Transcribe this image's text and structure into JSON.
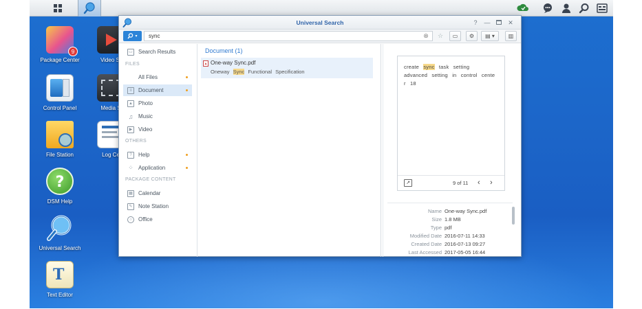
{
  "window": {
    "title": "Universal Search"
  },
  "search": {
    "query": "sync"
  },
  "sidebar": {
    "search_results": "Search Results",
    "files_header": "FILES",
    "all_files": "All Files",
    "document": "Document",
    "photo": "Photo",
    "music": "Music",
    "video": "Video",
    "others_header": "OTHERS",
    "help": "Help",
    "application": "Application",
    "package_header": "PACKAGE CONTENT",
    "calendar": "Calendar",
    "note_station": "Note Station",
    "office": "Office"
  },
  "results": {
    "heading": "Document (1)",
    "item": {
      "name": "One-way Sync.pdf",
      "sub_before": "Oneway",
      "sub_highlight": "Sync",
      "sub_after": "Functional  Specification"
    }
  },
  "preview": {
    "line1_a": "create",
    "line1_hl": "sync",
    "line1_b": "task  setting",
    "line2": "advanced  setting  in  control  cente",
    "line3": "r  18",
    "page_indicator": "9 of 11"
  },
  "properties": [
    {
      "key": "Name",
      "value": "One-way Sync.pdf"
    },
    {
      "key": "Size",
      "value": "1.8 MB"
    },
    {
      "key": "Type",
      "value": "pdf"
    },
    {
      "key": "Modified Date",
      "value": "2016-07-11 14:33"
    },
    {
      "key": "Created Date",
      "value": "2016-07-13 09:27"
    },
    {
      "key": "Last Accessed",
      "value": "2017-05-05 16:44"
    }
  ],
  "desktop": {
    "package_center": "Package Center",
    "package_badge": "9",
    "video_station": "Video St",
    "control_panel": "Control Panel",
    "media_server": "Media S",
    "file_station": "File Station",
    "log_center": "Log Ce",
    "dsm_help": "DSM Help",
    "universal_search": "Universal Search",
    "text_editor": "Text Editor"
  },
  "colors": {
    "accent": "#2c84d8",
    "highlight": "#f7d98a",
    "desktop_blue": "#1d6fd0"
  }
}
